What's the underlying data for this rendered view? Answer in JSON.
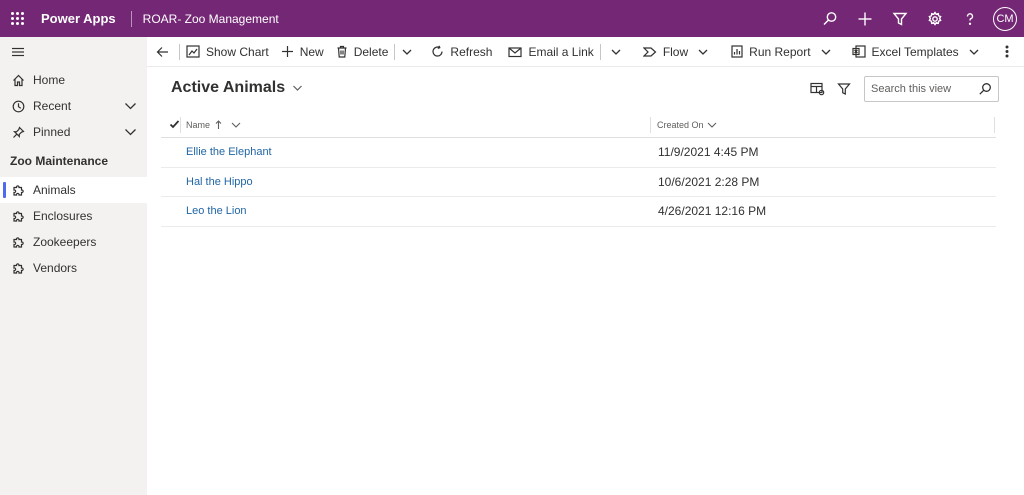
{
  "topbar": {
    "brand": "Power Apps",
    "app_name": "ROAR- Zoo Management",
    "user_initials": "CM",
    "icons": [
      "waffle-icon",
      "search-icon",
      "plus-icon",
      "filter-icon",
      "settings-icon",
      "help-icon"
    ],
    "background": "#742774"
  },
  "sidebar": {
    "items": [
      {
        "label": "Home",
        "icon": "home-icon"
      },
      {
        "label": "Recent",
        "icon": "clock-icon"
      },
      {
        "label": "Pinned",
        "icon": "pin-icon"
      }
    ],
    "group_title": "Zoo Maintenance",
    "entities": [
      {
        "label": "Animals",
        "icon": "puzzle-icon",
        "active": true
      },
      {
        "label": "Enclosures",
        "icon": "puzzle-icon",
        "active": false
      },
      {
        "label": "Zookeepers",
        "icon": "puzzle-icon",
        "active": false
      },
      {
        "label": "Vendors",
        "icon": "puzzle-icon",
        "active": false
      }
    ],
    "active_accent": "#4f6bed"
  },
  "commandbar": {
    "show_chart": "Show Chart",
    "new": "New",
    "delete": "Delete",
    "refresh": "Refresh",
    "email_link": "Email a Link",
    "flow": "Flow",
    "run_report": "Run Report",
    "excel_templates": "Excel Templates"
  },
  "view": {
    "title": "Active Animals",
    "search_placeholder": "Search this view"
  },
  "grid": {
    "columns": [
      "Name",
      "Created On"
    ],
    "rows": [
      {
        "name": "Ellie the Elephant",
        "created_on": "11/9/2021 4:45 PM"
      },
      {
        "name": "Hal the Hippo",
        "created_on": "10/6/2021 2:28 PM"
      },
      {
        "name": "Leo the Lion",
        "created_on": "4/26/2021 12:16 PM"
      }
    ],
    "link_color": "#2266a5"
  }
}
